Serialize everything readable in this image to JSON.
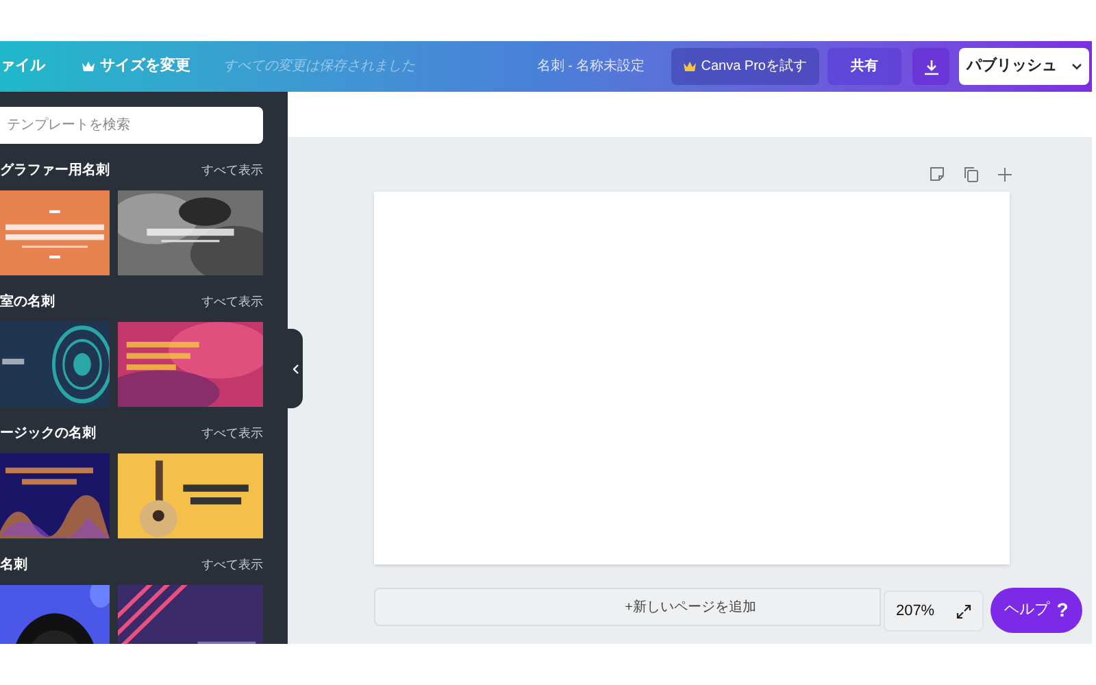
{
  "topbar": {
    "file_menu": "ァイル",
    "resize": "サイズを変更",
    "save_status": "すべての変更は保存されました",
    "doc_title": "名刺 - 名称未設定",
    "pro_button": "Canva Proを試す",
    "share_button": "共有",
    "publish_button": "パブリッシュ"
  },
  "sidebar": {
    "search": {
      "placeholder": "テンプレートを検索"
    },
    "sections": [
      {
        "title": "グラファー用名刺",
        "see_all": "すべて表示"
      },
      {
        "title": "室の名刺",
        "see_all": "すべて表示"
      },
      {
        "title": "ージックの名刺",
        "see_all": "すべて表示"
      },
      {
        "title": "名刺",
        "see_all": "すべて表示"
      }
    ]
  },
  "editor": {
    "add_page": "+新しいページを追加",
    "zoom": "207%",
    "help_button": "ヘルプ",
    "help_icon": "?"
  }
}
